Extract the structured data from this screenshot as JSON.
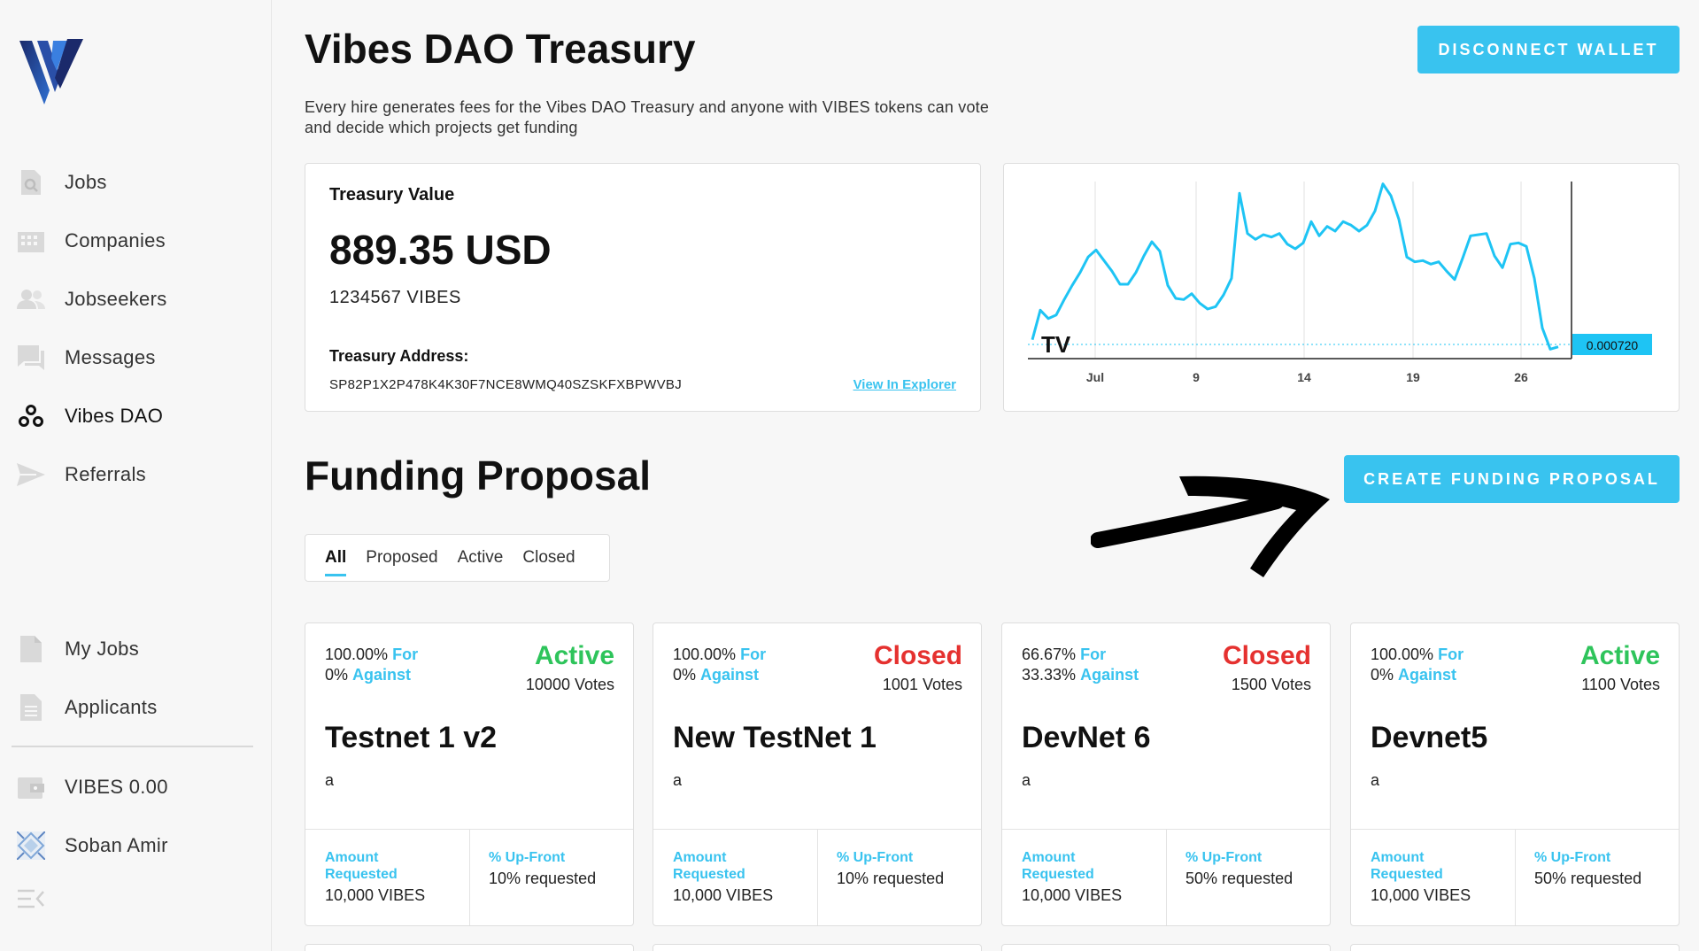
{
  "sidebar": {
    "logo": "vibes-logo",
    "items": [
      {
        "label": "Jobs",
        "icon": "job-search-icon"
      },
      {
        "label": "Companies",
        "icon": "building-icon"
      },
      {
        "label": "Jobseekers",
        "icon": "people-icon"
      },
      {
        "label": "Messages",
        "icon": "chat-icon"
      },
      {
        "label": "Vibes DAO",
        "icon": "dao-icon",
        "active": true
      },
      {
        "label": "Referrals",
        "icon": "send-icon"
      }
    ],
    "bottom_items": [
      {
        "label": "My Jobs",
        "icon": "document-icon"
      },
      {
        "label": "Applicants",
        "icon": "document-lines-icon"
      }
    ],
    "wallet": {
      "label": "VIBES 0.00",
      "icon": "wallet-icon"
    },
    "user": {
      "label": "Soban Amir",
      "icon": "avatar"
    },
    "collapse_icon": "collapse-menu-icon"
  },
  "header": {
    "title": "Vibes DAO Treasury",
    "description": "Every hire generates fees for the Vibes DAO Treasury and anyone with VIBES tokens can vote and decide which projects get funding",
    "disconnect_label": "DISCONNECT WALLET"
  },
  "treasury": {
    "label": "Treasury Value",
    "usd": "889.35 USD",
    "vibes": "1234567 VIBES",
    "address_label": "Treasury Address:",
    "address": "SP82P1X2P478K4K30F7NCE8WMQ40SZSKFXBPWVBJ",
    "explorer_link": "View In Explorer"
  },
  "chart_data": {
    "type": "line",
    "x_ticks": [
      "Jul",
      "9",
      "14",
      "19",
      "26"
    ],
    "last_value_label": "0.000720",
    "baseline": 0.00072,
    "ylim": [
      0.0006,
      0.0021
    ],
    "grid": "vertical",
    "watermark": "TV",
    "color": "#1ec4f4",
    "series": [
      {
        "values": [
          0.00076,
          0.00101,
          0.00094,
          0.00097,
          0.0011,
          0.00122,
          0.00133,
          0.00146,
          0.00152,
          0.00143,
          0.00134,
          0.00123,
          0.00123,
          0.00133,
          0.00147,
          0.00159,
          0.00151,
          0.00122,
          0.00111,
          0.0011,
          0.00115,
          0.00107,
          0.00102,
          0.00104,
          0.00114,
          0.00128,
          0.002,
          0.00166,
          0.00161,
          0.00165,
          0.00163,
          0.00166,
          0.00157,
          0.00153,
          0.00158,
          0.00176,
          0.00164,
          0.00172,
          0.00168,
          0.00176,
          0.00173,
          0.00168,
          0.00173,
          0.00185,
          0.00208,
          0.00198,
          0.00178,
          0.00146,
          0.00142,
          0.00143,
          0.0014,
          0.00142,
          0.00134,
          0.00127,
          0.00145,
          0.00164,
          0.00165,
          0.00166,
          0.00147,
          0.00137,
          0.00157,
          0.00158,
          0.00155,
          0.00128,
          0.00086,
          0.00068,
          0.0007
        ]
      }
    ]
  },
  "funding": {
    "title": "Funding Proposal",
    "create_label": "CREATE FUNDING PROPOSAL",
    "tabs": [
      {
        "label": "All",
        "active": true
      },
      {
        "label": "Proposed"
      },
      {
        "label": "Active"
      },
      {
        "label": "Closed"
      }
    ],
    "for_label": "For",
    "against_label": "Against",
    "amount_label": "Amount Requested",
    "upfront_label": "% Up-Front",
    "proposals": [
      {
        "for_pct": "100.00%",
        "against_pct": "0%",
        "status": "Active",
        "votes": "10000 Votes",
        "title": "Testnet 1 v2",
        "desc": "a",
        "amount": "10,000 VIBES",
        "upfront": "10% requested"
      },
      {
        "for_pct": "100.00%",
        "against_pct": "0%",
        "status": "Closed",
        "votes": "1001 Votes",
        "title": "New TestNet 1",
        "desc": "a",
        "amount": "10,000 VIBES",
        "upfront": "10% requested"
      },
      {
        "for_pct": "66.67%",
        "against_pct": "33.33%",
        "status": "Closed",
        "votes": "1500 Votes",
        "title": "DevNet 6",
        "desc": "a",
        "amount": "10,000 VIBES",
        "upfront": "50% requested"
      },
      {
        "for_pct": "100.00%",
        "against_pct": "0%",
        "status": "Active",
        "votes": "1100 Votes",
        "title": "Devnet5",
        "desc": "a",
        "amount": "10,000 VIBES",
        "upfront": "50% requested"
      }
    ]
  },
  "colors": {
    "accent": "#39c3ef",
    "active": "#2ec45b",
    "closed": "#e5312f"
  }
}
